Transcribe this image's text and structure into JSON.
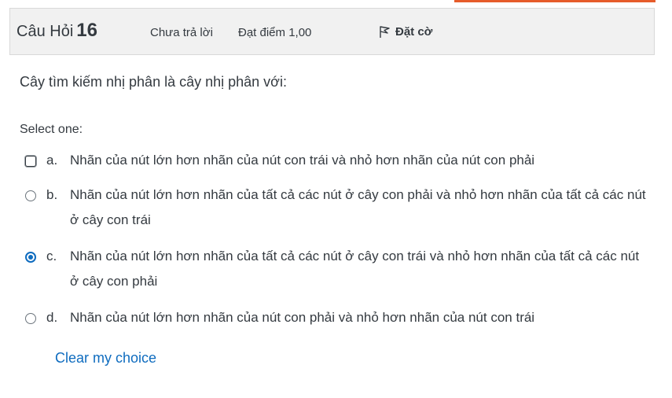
{
  "question": {
    "label": "Câu Hỏi",
    "number": "16",
    "state": "Chưa trả lời",
    "grade": "Đạt điểm 1,00",
    "flag_label": "Đặt cờ",
    "text": "Cây tìm kiếm nhị phân là cây nhị phân với:",
    "prompt": "Select one:"
  },
  "answers": [
    {
      "letter": "a.",
      "text": "Nhãn của nút lớn hơn nhãn của nút con trái và nhỏ hơn nhãn của nút con phải",
      "selected": false
    },
    {
      "letter": "b.",
      "text": "Nhãn của nút lớn hơn nhãn của tất cả các nút ở cây con phải và nhỏ hơn nhãn của tất cả các nút ở cây con trái",
      "selected": false
    },
    {
      "letter": "c.",
      "text": "Nhãn của nút lớn hơn nhãn của tất cả các nút ở cây con trái và nhỏ hơn nhãn của tất cả các nút ở cây con phải",
      "selected": true
    },
    {
      "letter": "d.",
      "text": "Nhãn của nút lớn hơn nhãn của nút con phải và nhỏ hơn nhãn của nút con trái",
      "selected": false
    }
  ],
  "clear_label": "Clear my choice",
  "colors": {
    "accent": "#0f6cbf",
    "tab_accent": "#e65c2b",
    "info_bg": "#f1f1f1"
  },
  "icons": {
    "flag": "flag-icon"
  }
}
